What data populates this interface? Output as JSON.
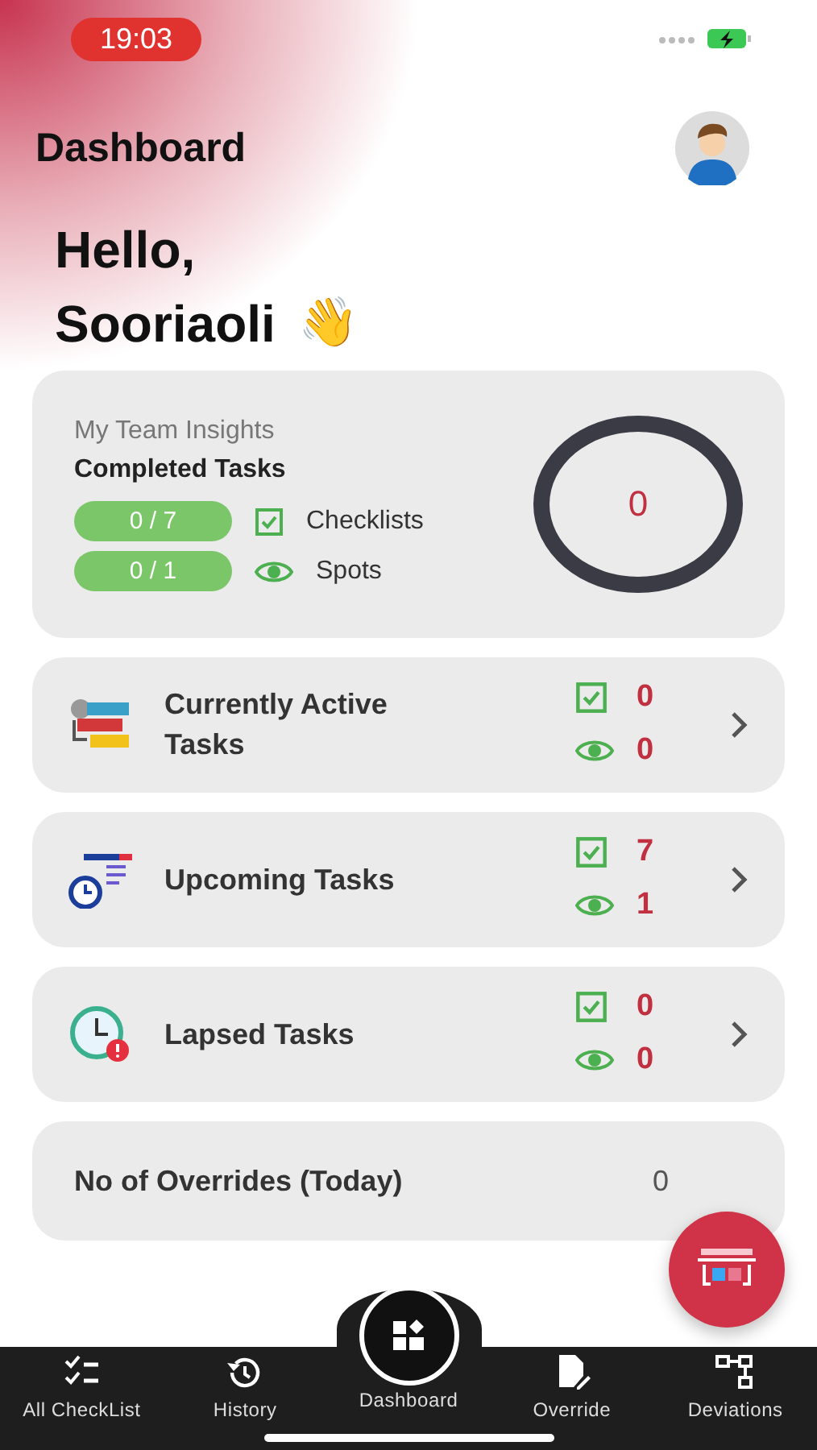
{
  "status_bar": {
    "time": "19:03"
  },
  "header": {
    "title": "Dashboard"
  },
  "greeting": {
    "line_1": "Hello,",
    "line_2": "Sooriaoli",
    "emoji": "👋"
  },
  "insights": {
    "title": "My Team Insights",
    "subtitle": "Completed Tasks",
    "rows": [
      {
        "kind": "checklist",
        "count": "0 / 7",
        "label": "Checklists"
      },
      {
        "kind": "spot",
        "count": "0 / 1",
        "label": "Spots"
      }
    ],
    "total": "0"
  },
  "task_cards": [
    {
      "kind": "active",
      "title": "Currently Active Tasks",
      "checklists": "0",
      "spots": "0"
    },
    {
      "kind": "upcoming",
      "title": "Upcoming Tasks",
      "checklists": "7",
      "spots": "1"
    },
    {
      "kind": "lapsed",
      "title": "Lapsed Tasks",
      "checklists": "0",
      "spots": "0"
    }
  ],
  "overrides": {
    "label": "No of Overrides (Today)",
    "value": "0"
  },
  "bottom_nav": [
    {
      "kind": "checklist",
      "label": "All CheckList",
      "selected": false
    },
    {
      "kind": "history",
      "label": "History",
      "selected": false
    },
    {
      "kind": "dashboard",
      "label": "Dashboard",
      "selected": true
    },
    {
      "kind": "override",
      "label": "Override",
      "selected": false
    },
    {
      "kind": "deviations",
      "label": "Deviations",
      "selected": false
    }
  ]
}
